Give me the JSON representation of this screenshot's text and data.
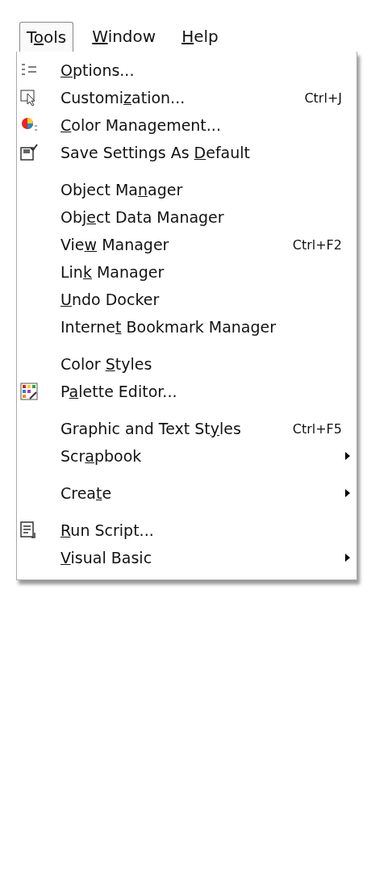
{
  "menubar": [
    {
      "pre": "T",
      "key": "o",
      "post": "ols",
      "selected": true
    },
    {
      "key": "W",
      "post": "indow",
      "selected": false
    },
    {
      "key": "H",
      "post": "elp",
      "selected": false
    }
  ],
  "menu_groups": [
    {
      "items": [
        {
          "key": "O",
          "post": "ptions...",
          "submenu": false
        },
        {
          "pre": "Customi",
          "key": "z",
          "post": "ation...",
          "shortcut": "Ctrl+J",
          "submenu": false
        },
        {
          "key": "C",
          "post": "olor Management...",
          "submenu": false
        },
        {
          "pre": "Save Settings As ",
          "key": "D",
          "post": "efault",
          "submenu": false
        }
      ]
    },
    {
      "items": [
        {
          "pre": "Object Ma",
          "key": "n",
          "post": "ager",
          "submenu": false
        },
        {
          "pre": "Obj",
          "key": "e",
          "post": "ct Data Manager",
          "submenu": false
        },
        {
          "pre": "Vie",
          "key": "w",
          "post": " Manager",
          "shortcut": "Ctrl+F2",
          "submenu": false
        },
        {
          "pre": "Lin",
          "key": "k",
          "post": " Manager",
          "submenu": false
        },
        {
          "key": "U",
          "post": "ndo Docker",
          "submenu": false
        },
        {
          "pre": "Interne",
          "key": "t",
          "post": " Bookmark Manager",
          "submenu": false
        }
      ]
    },
    {
      "items": [
        {
          "pre": "Color ",
          "key": "S",
          "post": "tyles",
          "submenu": false
        },
        {
          "pre": "P",
          "key": "a",
          "post": "lette Editor...",
          "submenu": false
        }
      ]
    },
    {
      "items": [
        {
          "pre": "Graphic and Text St",
          "key": "y",
          "post": "les",
          "shortcut": "Ctrl+F5",
          "submenu": false
        },
        {
          "pre": "Scr",
          "key": "a",
          "post": "pbook",
          "submenu": true
        }
      ]
    },
    {
      "items": [
        {
          "pre": "Crea",
          "key": "t",
          "post": "e",
          "submenu": true
        }
      ]
    },
    {
      "items": [
        {
          "key": "R",
          "post": "un Script...",
          "submenu": false
        },
        {
          "key": "V",
          "post": "isual Basic",
          "submenu": true
        }
      ]
    }
  ]
}
